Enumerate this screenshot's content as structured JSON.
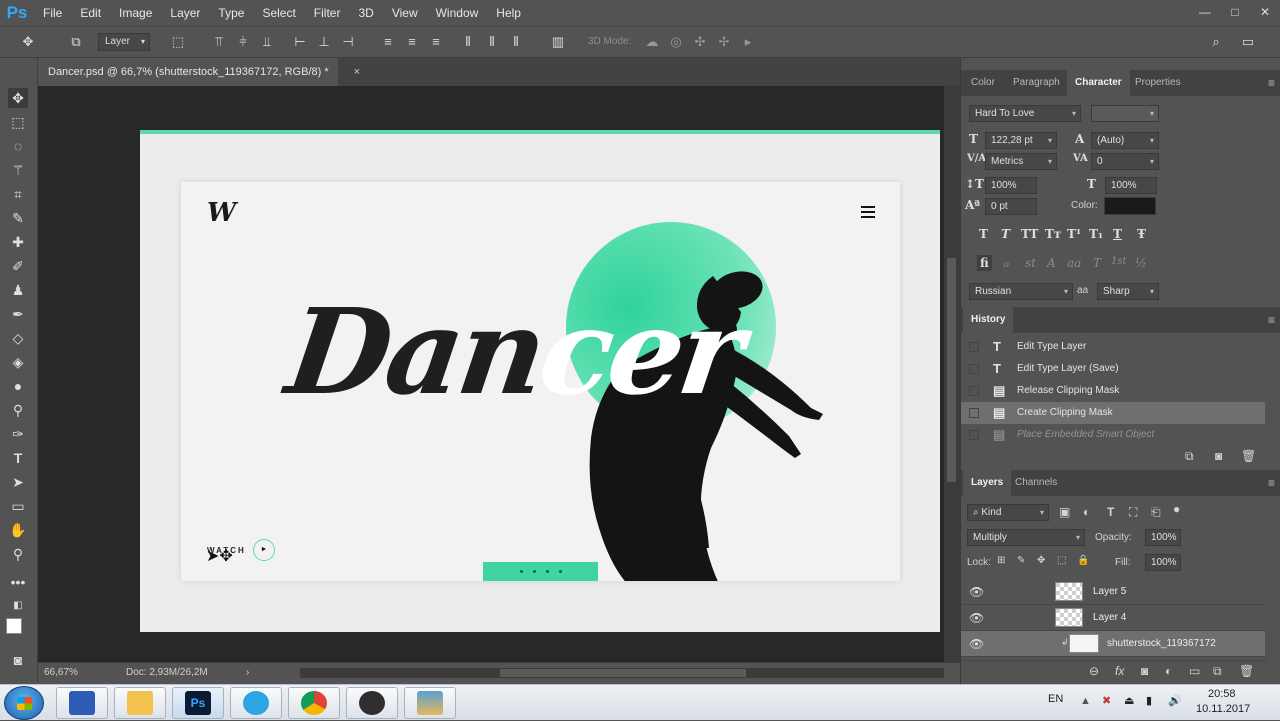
{
  "app": {
    "logo": "Ps",
    "window_controls": [
      "—",
      "□",
      "✕"
    ]
  },
  "menu": [
    "File",
    "Edit",
    "Image",
    "Layer",
    "Type",
    "Select",
    "Filter",
    "3D",
    "View",
    "Window",
    "Help"
  ],
  "options_bar": {
    "auto_select_value": "Layer",
    "mode_3d_label": "3D Mode:"
  },
  "document": {
    "tab_title": "Dancer.psd @ 66,7% (shutterstock_119367172, RGB/8) *",
    "close": "×"
  },
  "canvas": {
    "logo": "W",
    "title_dark": "Dan",
    "title_light": "cer",
    "watch_label": "WATCH",
    "play_icon": "►",
    "accent_color": "#3fd4a0"
  },
  "status": {
    "zoom": "66,67%",
    "doc": "Doc: 2,93M/26,2M",
    "arrow": "›"
  },
  "character_panel": {
    "tabs": [
      "Color",
      "Paragraph",
      "Character",
      "Properties"
    ],
    "active_tab": "Character",
    "font_family": "Hard To Love",
    "font_style": "",
    "font_size": "122,28 pt",
    "leading": "(Auto)",
    "kerning": "Metrics",
    "tracking": "0",
    "vertical_scale": "100%",
    "horizontal_scale": "100%",
    "baseline_shift": "0 pt",
    "color_label": "Color:",
    "color_value": "#1a1a1a",
    "type_styles": [
      "T",
      "T",
      "TT",
      "Tт",
      "T¹",
      "T₁",
      "T",
      "Ŧ"
    ],
    "opentype": [
      "fi",
      "ℴ",
      "st",
      "A",
      "aa",
      "T",
      "1st",
      "½"
    ],
    "language": "Russian",
    "aa_label": "aa",
    "anti_alias": "Sharp"
  },
  "history_panel": {
    "title": "History",
    "items": [
      {
        "icon": "T",
        "label": "Edit Type Layer"
      },
      {
        "icon": "T",
        "label": "Edit Type Layer (Save)"
      },
      {
        "icon": "▤",
        "label": "Release Clipping Mask"
      },
      {
        "icon": "▤",
        "label": "Create Clipping Mask"
      },
      {
        "icon": "▤",
        "label": "Place Embedded Smart Object"
      }
    ],
    "selected_index": 3
  },
  "layers_panel": {
    "tabs": [
      "Layers",
      "Channels"
    ],
    "filter_kind": "Kind",
    "blend_mode": "Multiply",
    "opacity_label": "Opacity:",
    "opacity": "100%",
    "lock_label": "Lock:",
    "fill_label": "Fill:",
    "fill": "100%",
    "layers": [
      {
        "name": "Layer 5"
      },
      {
        "name": "Layer 4"
      },
      {
        "name": "shutterstock_119367172"
      }
    ],
    "selected_index": 2,
    "footer_fx": "fx"
  },
  "taskbar": {
    "lang": "EN",
    "time": "20:58",
    "date": "10.11.2017",
    "apps": [
      "save-app-icon",
      "explorer-icon",
      "photoshop-icon",
      "telegram-icon",
      "chrome-icon",
      "obs-icon",
      "photos-icon"
    ],
    "ps_label": "Ps"
  }
}
